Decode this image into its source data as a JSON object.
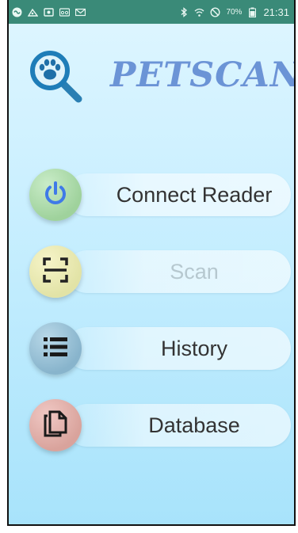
{
  "status_bar": {
    "battery": "70%",
    "time": "21:31",
    "icons": [
      "infinity-icon",
      "mms-icon",
      "image-icon",
      "voicemail-icon",
      "mail-icon",
      "bluetooth-icon",
      "wifi-icon",
      "do-not-disturb-icon",
      "battery-icon"
    ]
  },
  "header": {
    "logo_icon": "paw-magnifier-icon",
    "title": "PETSCAN"
  },
  "menu": [
    {
      "label": "Connect Reader",
      "icon": "power-icon",
      "color": "#a6d6a4",
      "enabled": true
    },
    {
      "label": "Scan",
      "icon": "scan-frame-icon",
      "color": "#e6e6ac",
      "enabled": false
    },
    {
      "label": "History",
      "icon": "list-icon",
      "color": "#8fb9cf",
      "enabled": true
    },
    {
      "label": "Database",
      "icon": "documents-icon",
      "color": "#dca9a2",
      "enabled": true
    }
  ]
}
